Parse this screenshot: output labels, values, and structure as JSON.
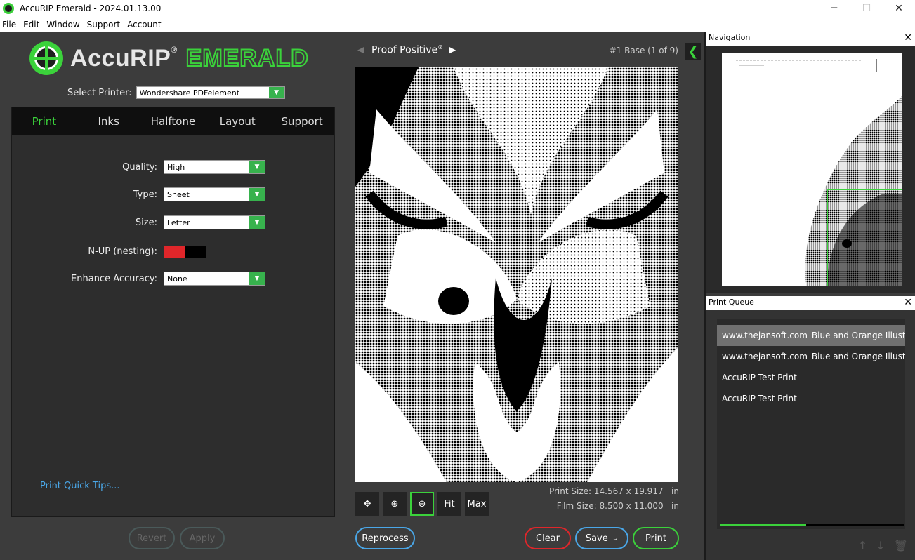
{
  "window": {
    "title": "AccuRIP Emerald - 2024.01.13.00",
    "controls": {
      "minimize": "─",
      "maximize": "☐",
      "close": "✕"
    }
  },
  "menu": [
    "File",
    "Edit",
    "Window",
    "Support",
    "Account"
  ],
  "logo": {
    "name": "AccuRIP",
    "reg": "®",
    "edition": "EMERALD"
  },
  "printer": {
    "label": "Select Printer:",
    "value": "Wondershare PDFelement"
  },
  "tabs": [
    "Print",
    "Inks",
    "Halftone",
    "Layout",
    "Support"
  ],
  "active_tab": "Print",
  "print_settings": {
    "quality": {
      "label": "Quality:",
      "value": "High"
    },
    "type": {
      "label": "Type:",
      "value": "Sheet"
    },
    "size": {
      "label": "Size:",
      "value": "Letter"
    },
    "nup": {
      "label": "N-UP (nesting):",
      "enabled": true
    },
    "enhance": {
      "label": "Enhance Accuracy:",
      "value": "None"
    }
  },
  "quick_tips": "Print Quick Tips...",
  "left_buttons": {
    "revert": "Revert",
    "apply": "Apply"
  },
  "preview": {
    "proof_name": "Proof Positive",
    "proof_reg": "®",
    "base_label": "#1 Base (1 of 9)",
    "print_size_label": "Print Size:",
    "print_size": "14.567 x 19.917",
    "film_size_label": "Film Size:",
    "film_size": "8.500 x 11.000",
    "unit": "in"
  },
  "tools": {
    "fit": "Fit",
    "max": "Max"
  },
  "center_buttons": {
    "reprocess": "Reprocess",
    "clear": "Clear",
    "save": "Save",
    "print": "Print"
  },
  "navigation": {
    "title": "Navigation",
    "close": "✕"
  },
  "queue": {
    "title": "Print Queue",
    "close": "✕",
    "items": [
      "www.thejansoft.com_Blue and Orange Illustrated",
      "www.thejansoft.com_Blue and Orange Illustrated",
      "AccuRIP Test Print",
      "AccuRIP Test Print"
    ],
    "progress": 0.47
  },
  "colors": {
    "accent": "#3bd23b",
    "clear": "#e0262a",
    "save": "#4aa7e8",
    "nup_on": "#e0262a"
  }
}
